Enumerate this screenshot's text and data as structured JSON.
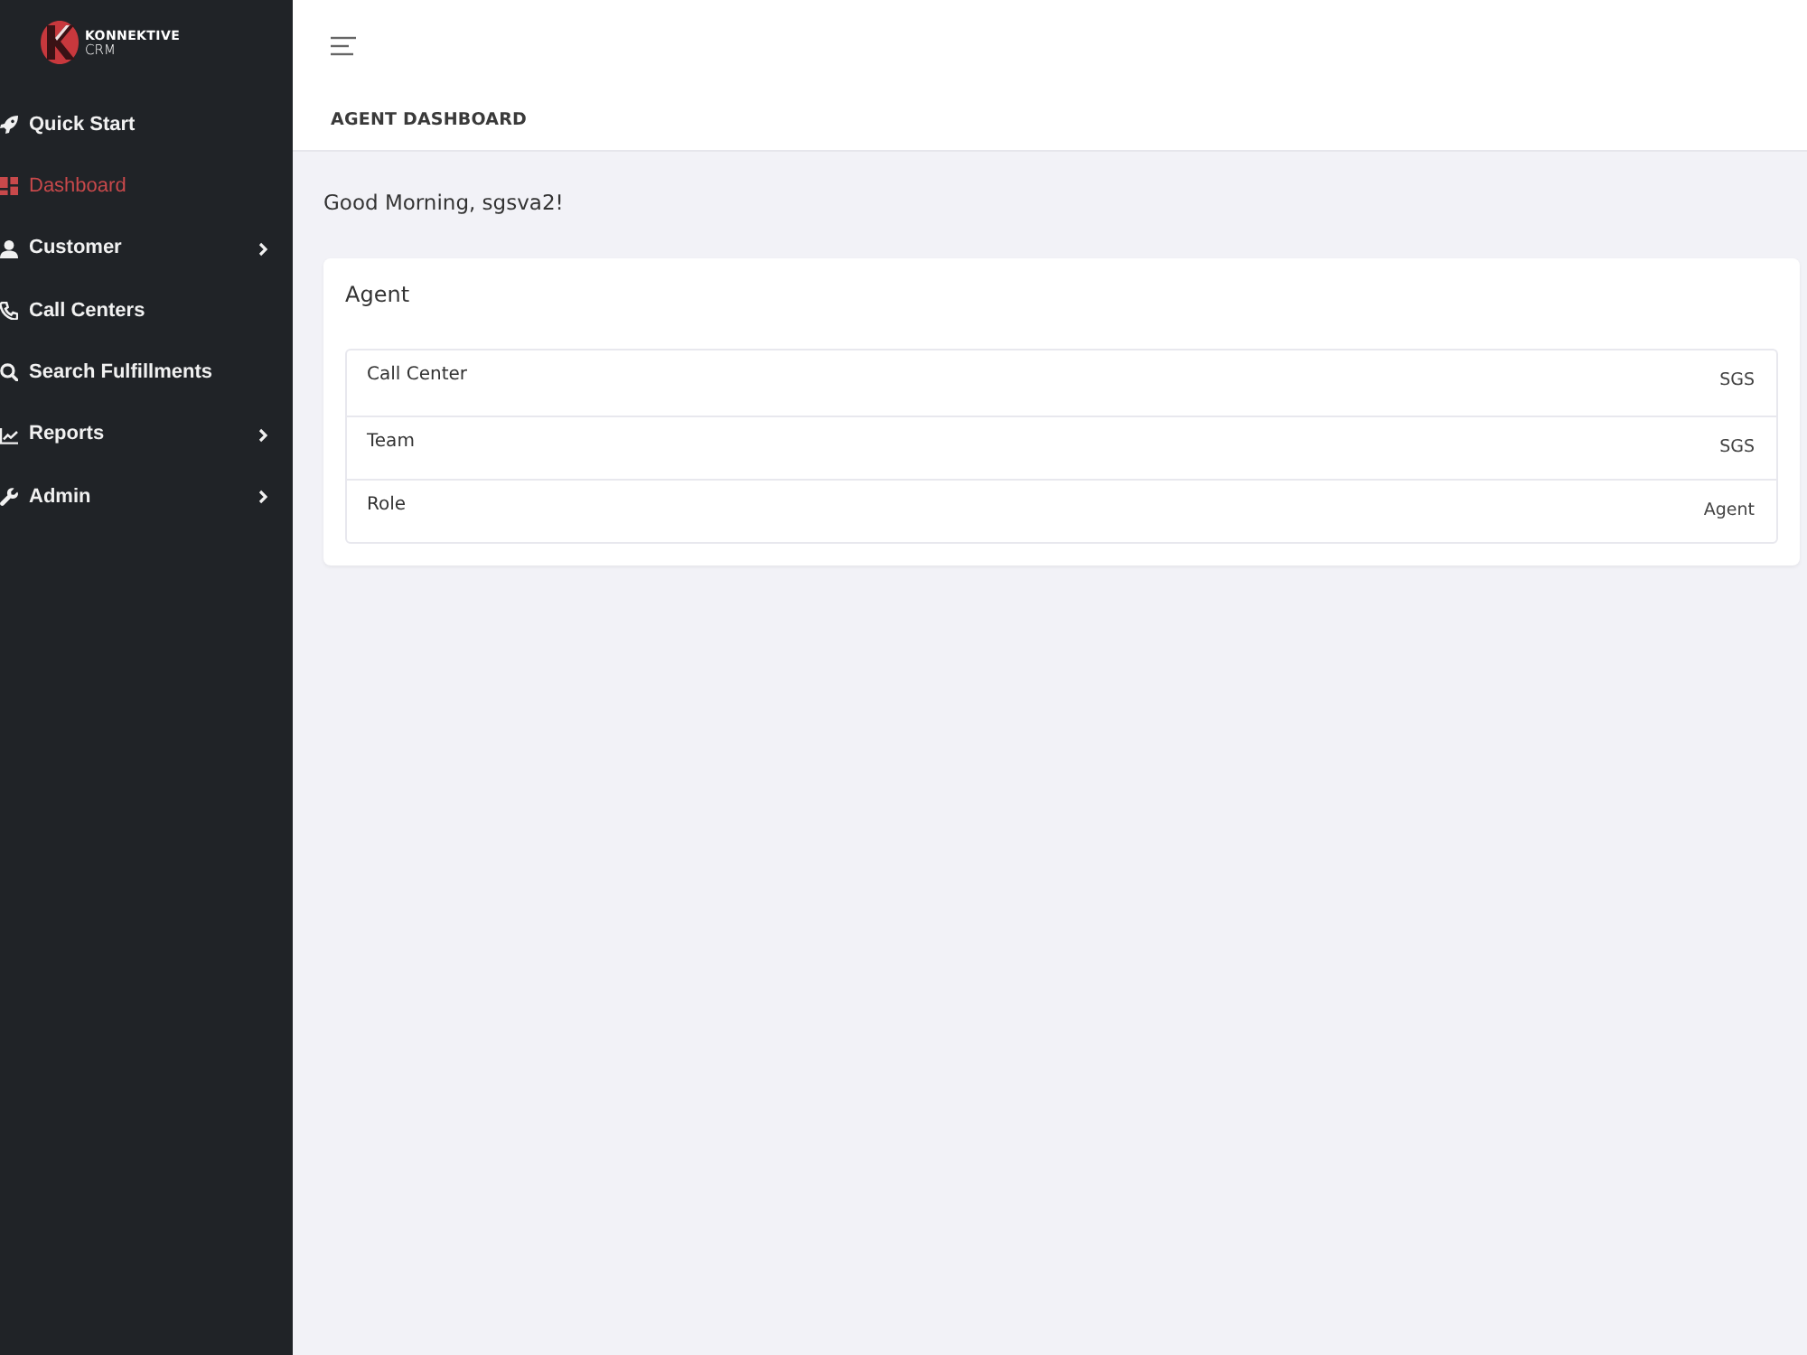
{
  "sidebar": {
    "logo": {
      "name": "KONNEKTIVE",
      "sub": "CRM"
    },
    "items": [
      {
        "label": "Quick Start",
        "kind": "link",
        "selected": false
      },
      {
        "label": "Dashboard",
        "kind": "link",
        "selected": true
      },
      {
        "label": "Customer",
        "kind": "submenu",
        "selected": false
      },
      {
        "label": "Call Centers",
        "kind": "link",
        "selected": false
      },
      {
        "label": "Search Fulfillments",
        "kind": "link",
        "selected": false
      },
      {
        "label": "Reports",
        "kind": "submenu",
        "selected": false
      },
      {
        "label": "Admin",
        "kind": "submenu",
        "selected": false
      }
    ]
  },
  "header": {
    "title": "AGENT DASHBOARD"
  },
  "greeting": "Good Morning, sgsva2!",
  "card": {
    "title": "Agent",
    "rows": [
      {
        "label": "Call Center",
        "value": "SGS"
      },
      {
        "label": "Team",
        "value": "SGS"
      },
      {
        "label": "Role",
        "value": "Agent"
      }
    ]
  }
}
